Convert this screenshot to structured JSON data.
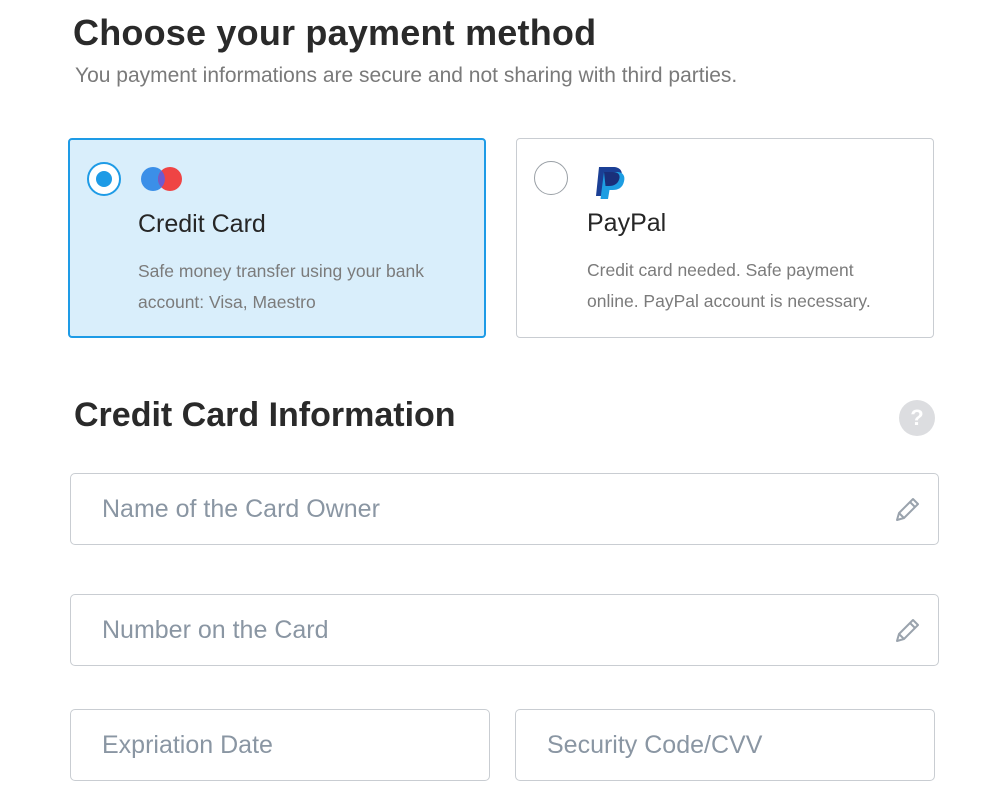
{
  "header": {
    "title": "Choose your payment method",
    "subtitle": "You payment informations are secure and not sharing with third parties."
  },
  "payment_methods": [
    {
      "label": "Credit Card",
      "description": "Safe money transfer using your bank account: Visa, Maestro",
      "selected": true,
      "icon": "maestro-card-icon"
    },
    {
      "label": "PayPal",
      "description": "Credit card needed. Safe payment online. PayPal account is necessary.",
      "selected": false,
      "icon": "paypal-logo-icon"
    }
  ],
  "card_info": {
    "title": "Credit Card Information",
    "help_label": "?",
    "fields": {
      "name": {
        "placeholder": "Name of the Card Owner",
        "value": "",
        "icon": "pencil-icon"
      },
      "number": {
        "placeholder": "Number on the Card",
        "value": "",
        "icon": "pencil-icon"
      },
      "expiration": {
        "placeholder": "Expriation Date",
        "value": ""
      },
      "cvv": {
        "placeholder": "Security Code/CVV",
        "value": ""
      }
    }
  },
  "colors": {
    "accent": "#1e9be6",
    "selected_bg": "#d9eefb",
    "border": "#c9cdd2",
    "placeholder": "#8a96a3"
  }
}
